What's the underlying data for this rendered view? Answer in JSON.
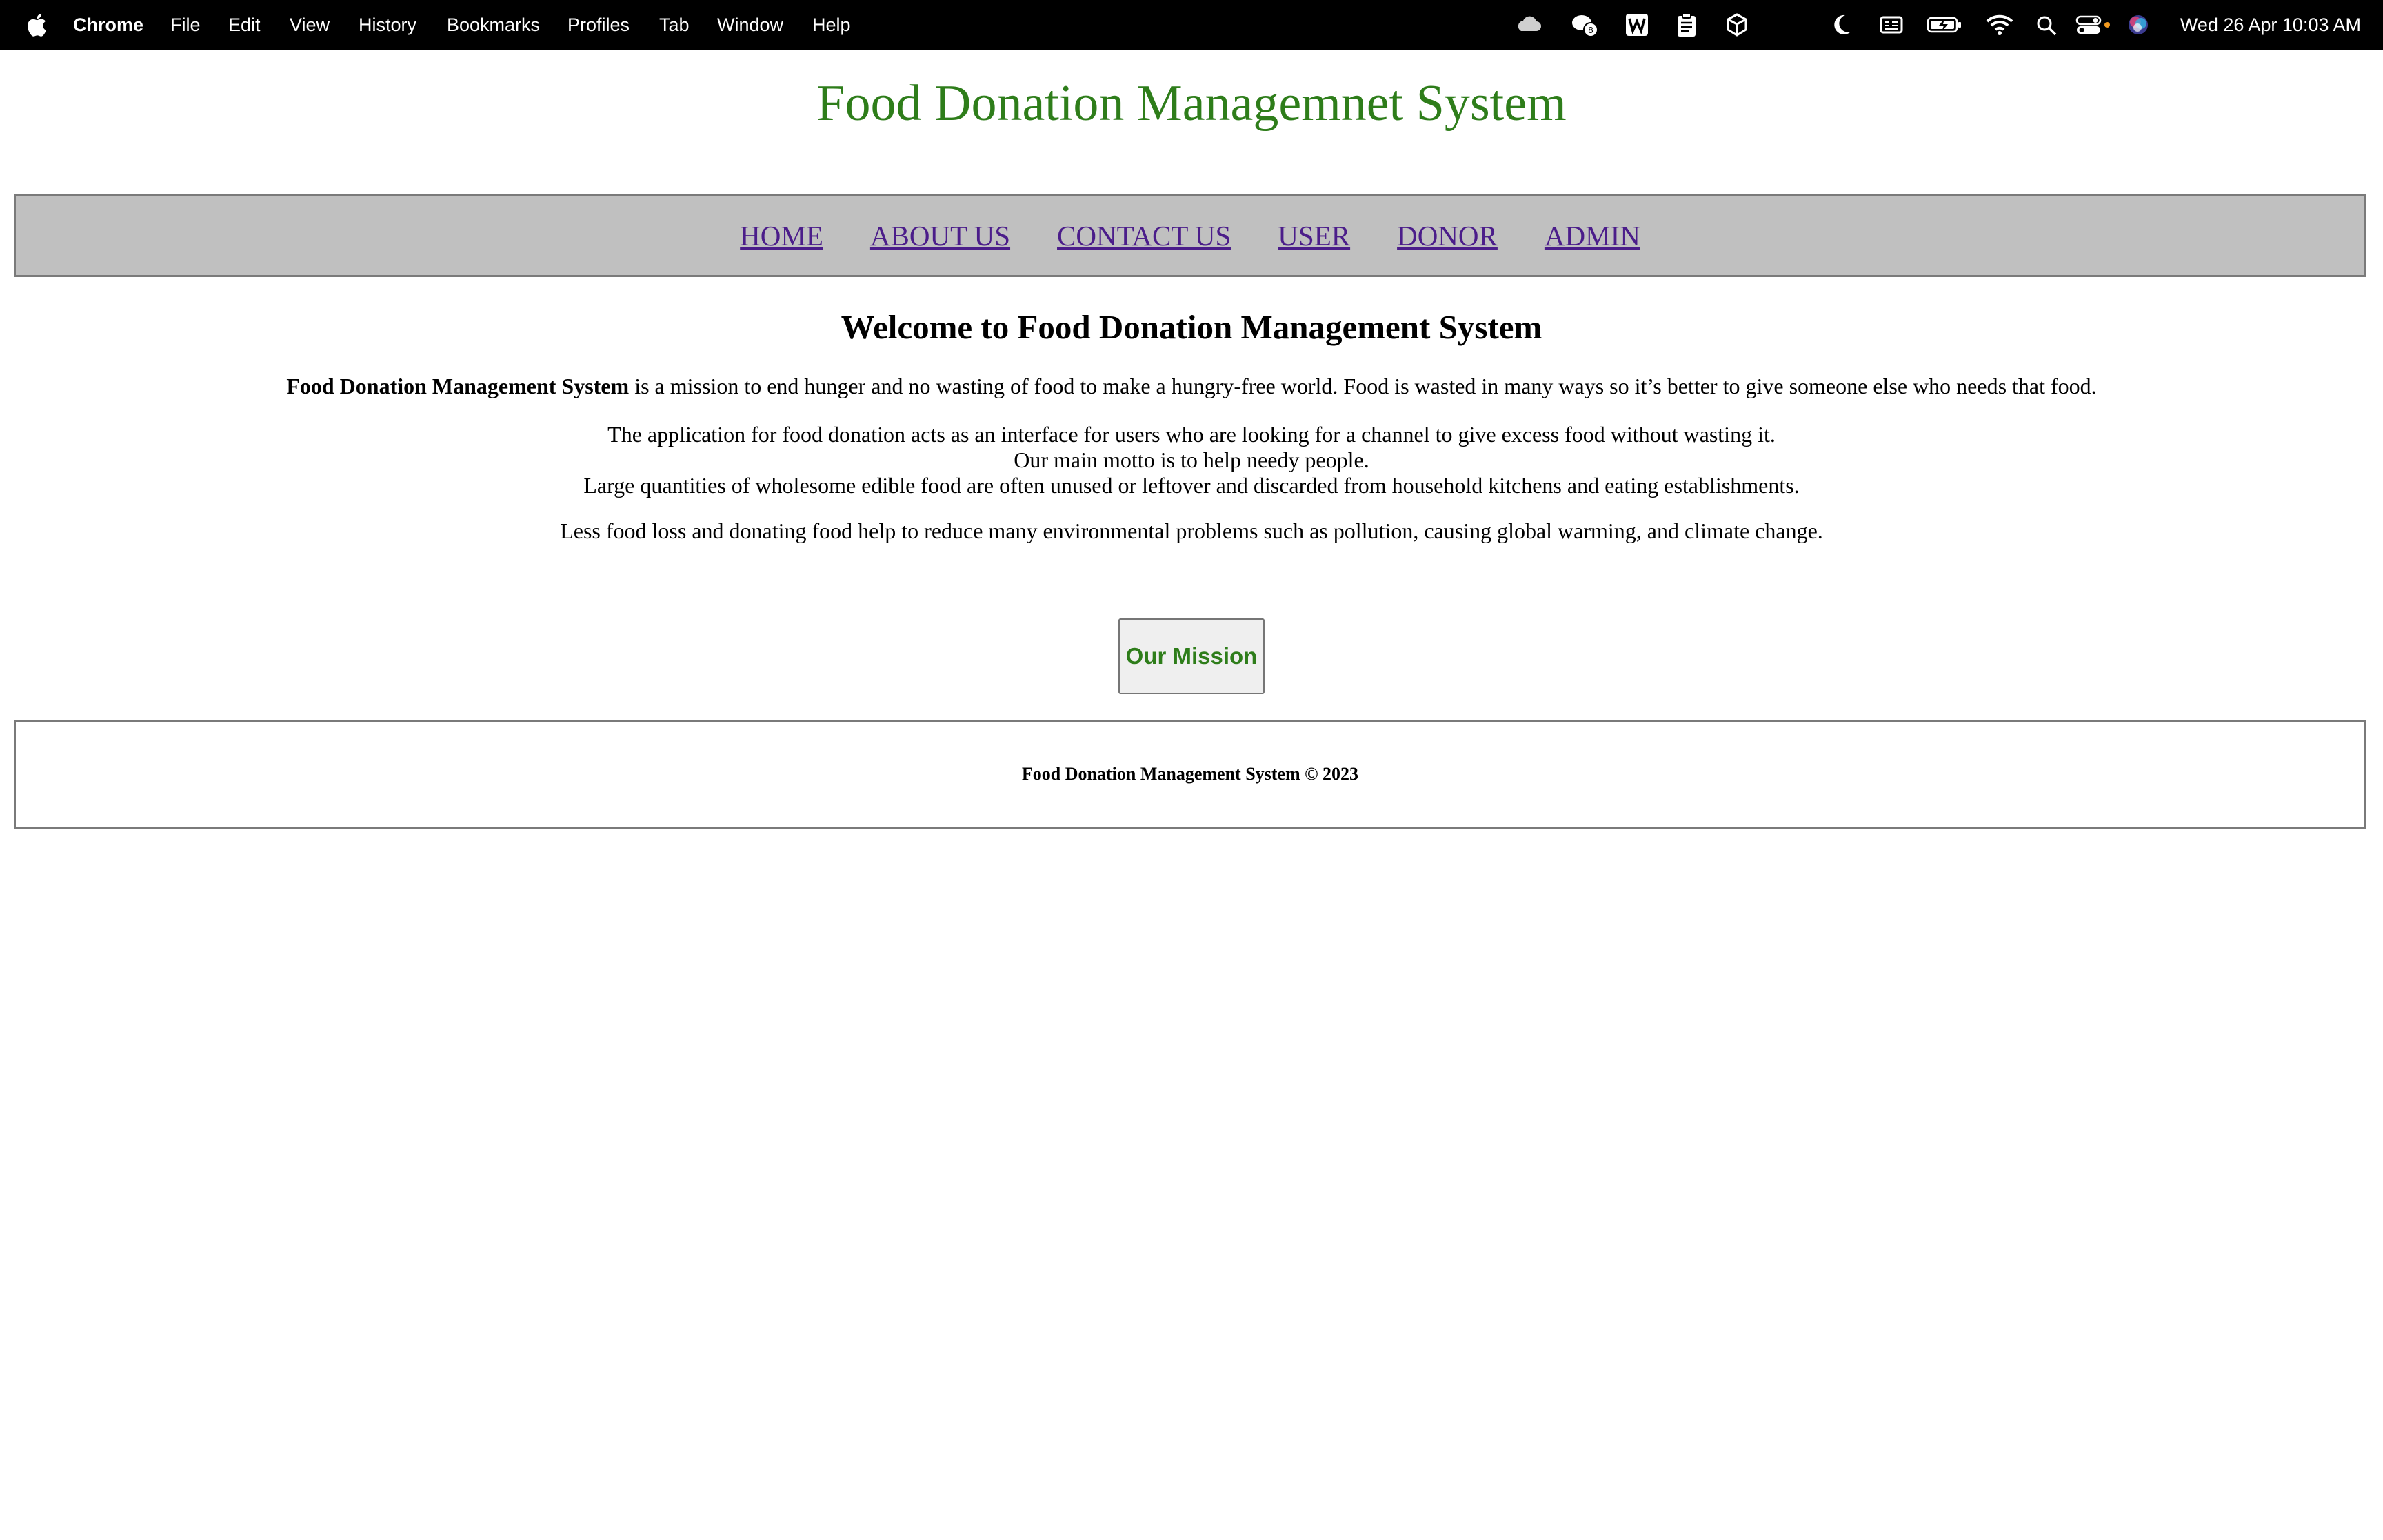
{
  "menubar": {
    "app_name": "Chrome",
    "menus": [
      "File",
      "Edit",
      "View",
      "History",
      "Bookmarks",
      "Profiles",
      "Tab",
      "Window",
      "Help"
    ],
    "clock": "Wed 26 Apr  10:03 AM",
    "status_icons": [
      "cloud-icon",
      "wechat-icon",
      "word-icon",
      "clipboard-icon",
      "box-icon",
      "moon-icon",
      "display-icon",
      "battery-charging-icon",
      "wifi-icon",
      "spotlight-search-icon",
      "control-center-icon",
      "siri-icon"
    ],
    "wechat_badge": "8"
  },
  "page": {
    "site_title": "Food Donation Managemnet System",
    "nav": [
      "HOME",
      "ABOUT US",
      "CONTACT US",
      "USER",
      "DONOR",
      "ADMIN"
    ],
    "welcome_heading": "Welcome to Food Donation Management System",
    "p1_bold": "Food Donation Management System",
    "p1_rest": " is a mission to end hunger and no wasting of food to make a hungry-free world. Food is wasted in many ways so it’s better to give someone else who needs that food.",
    "p2_lines": [
      "The application for food donation acts as an interface for users who are looking for a channel to give excess food without wasting it.",
      "Our main motto is to help needy people.",
      "Large quantities of wholesome edible food are often unused or leftover and discarded from household kitchens and eating establishments."
    ],
    "p3": "Less food loss and donating food help to reduce many environmental problems such as pollution, causing global warming, and climate change.",
    "mission_button": "Our Mission",
    "footer": "Food Donation Management System © 2023"
  },
  "colors": {
    "title_green": "#2e7d1a",
    "nav_bg": "#c0c0c0",
    "link_visited": "#4b1d8a"
  }
}
